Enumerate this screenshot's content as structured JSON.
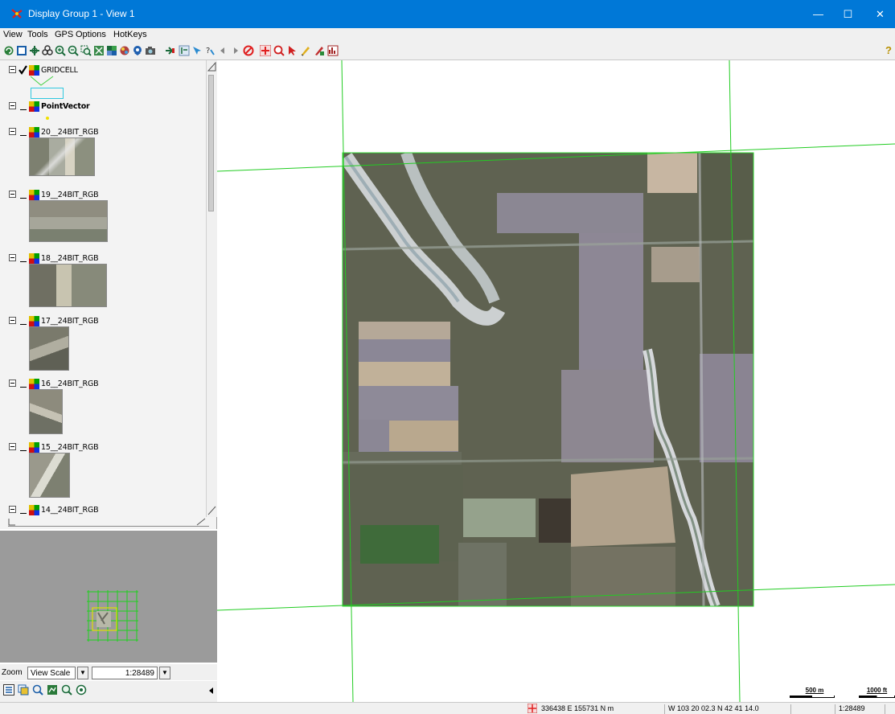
{
  "window": {
    "title": "Display Group 1 - View 1",
    "minimize_glyph": "—",
    "maximize_glyph": "☐",
    "close_glyph": "✕"
  },
  "menu": [
    "View",
    "Tools",
    "GPS",
    "Options",
    "HotKeys"
  ],
  "toolbar": {
    "icons": [
      "redraw-icon",
      "fit-icon",
      "pan-icon",
      "recenter-icon",
      "zoom-in-icon",
      "zoom-out-icon",
      "zoom-box-icon",
      "full-extent-icon",
      "layer-icon",
      "color-icon",
      "gps-icon",
      "camera-icon",
      "arrow-icon",
      "select-icon",
      "identify-icon",
      "info-icon",
      "prev-icon",
      "next-icon",
      "stop-icon",
      "crosshair-icon",
      "zoom-tool-icon",
      "pointer-icon",
      "pencil-icon",
      "marker-icon",
      "chart-icon"
    ],
    "help_glyph": "?"
  },
  "layers": [
    {
      "name": "GRIDCELL",
      "checked": true
    },
    {
      "name": "PointVector",
      "checked": false
    },
    {
      "name": "20__24BIT_RGB",
      "checked": false
    },
    {
      "name": "19__24BIT_RGB",
      "checked": false
    },
    {
      "name": "18__24BIT_RGB",
      "checked": false
    },
    {
      "name": "17__24BIT_RGB",
      "checked": false
    },
    {
      "name": "16__24BIT_RGB",
      "checked": false
    },
    {
      "name": "15__24BIT_RGB",
      "checked": false
    },
    {
      "name": "14__24BIT_RGB",
      "checked": false
    }
  ],
  "zoom": {
    "label": "Zoom",
    "mode": "View Scale",
    "scale": "1:28489"
  },
  "scalebar": {
    "metric": "500 m",
    "imperial": "1000 ft"
  },
  "status": {
    "projected": "336438 E  155731 N m",
    "geographic": "W 103 20 02.3  N 42 41 14.0",
    "scale": "1:28489"
  },
  "colors": {
    "titlebar": "#0078d7",
    "grid_lines": "#22cc22",
    "locator_bg": "#9b9b9b"
  }
}
